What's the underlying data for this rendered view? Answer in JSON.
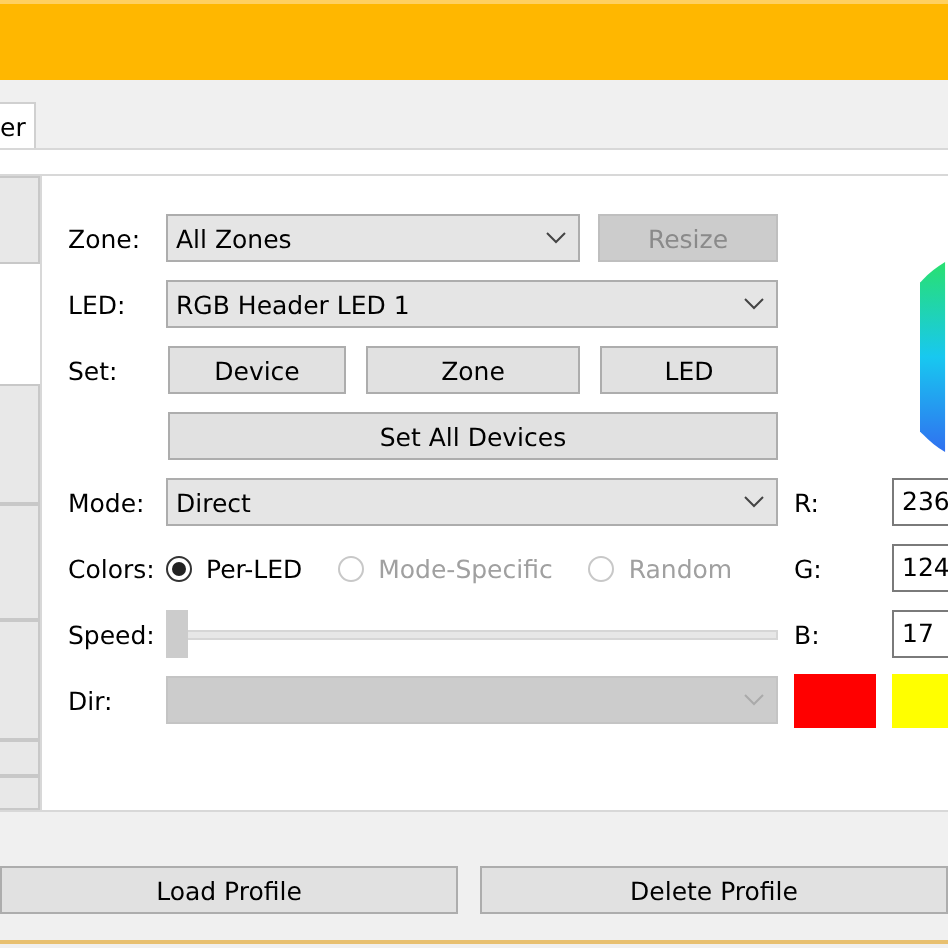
{
  "tabs": [
    {
      "label": "er",
      "selected": true
    }
  ],
  "zone": {
    "label": "Zone:",
    "value": "All Zones"
  },
  "resize_button": {
    "label": "Resize",
    "disabled": true
  },
  "led": {
    "label": "LED:",
    "value": "RGB Header LED 1"
  },
  "set": {
    "label": "Set:",
    "buttons": [
      "Device",
      "Zone",
      "LED"
    ]
  },
  "set_all_button": "Set All Devices",
  "mode": {
    "label": "Mode:",
    "value": "Direct"
  },
  "colors": {
    "label": "Colors:",
    "options": [
      {
        "label": "Per-LED",
        "selected": true,
        "disabled": false
      },
      {
        "label": "Mode-Specific",
        "selected": false,
        "disabled": true
      },
      {
        "label": "Random",
        "selected": false,
        "disabled": true
      }
    ]
  },
  "speed": {
    "label": "Speed:",
    "level": 0
  },
  "dir": {
    "label": "Dir:",
    "disabled": true
  },
  "rgb": [
    {
      "label": "R:",
      "value": "236"
    },
    {
      "label": "G:",
      "value": "124"
    },
    {
      "label": "B:",
      "value": "17"
    }
  ],
  "swatches": [
    {
      "color": "#ff0000"
    },
    {
      "color": "#ffff00"
    }
  ],
  "profile_buttons": [
    "Load Profile",
    "Delete Profile"
  ]
}
